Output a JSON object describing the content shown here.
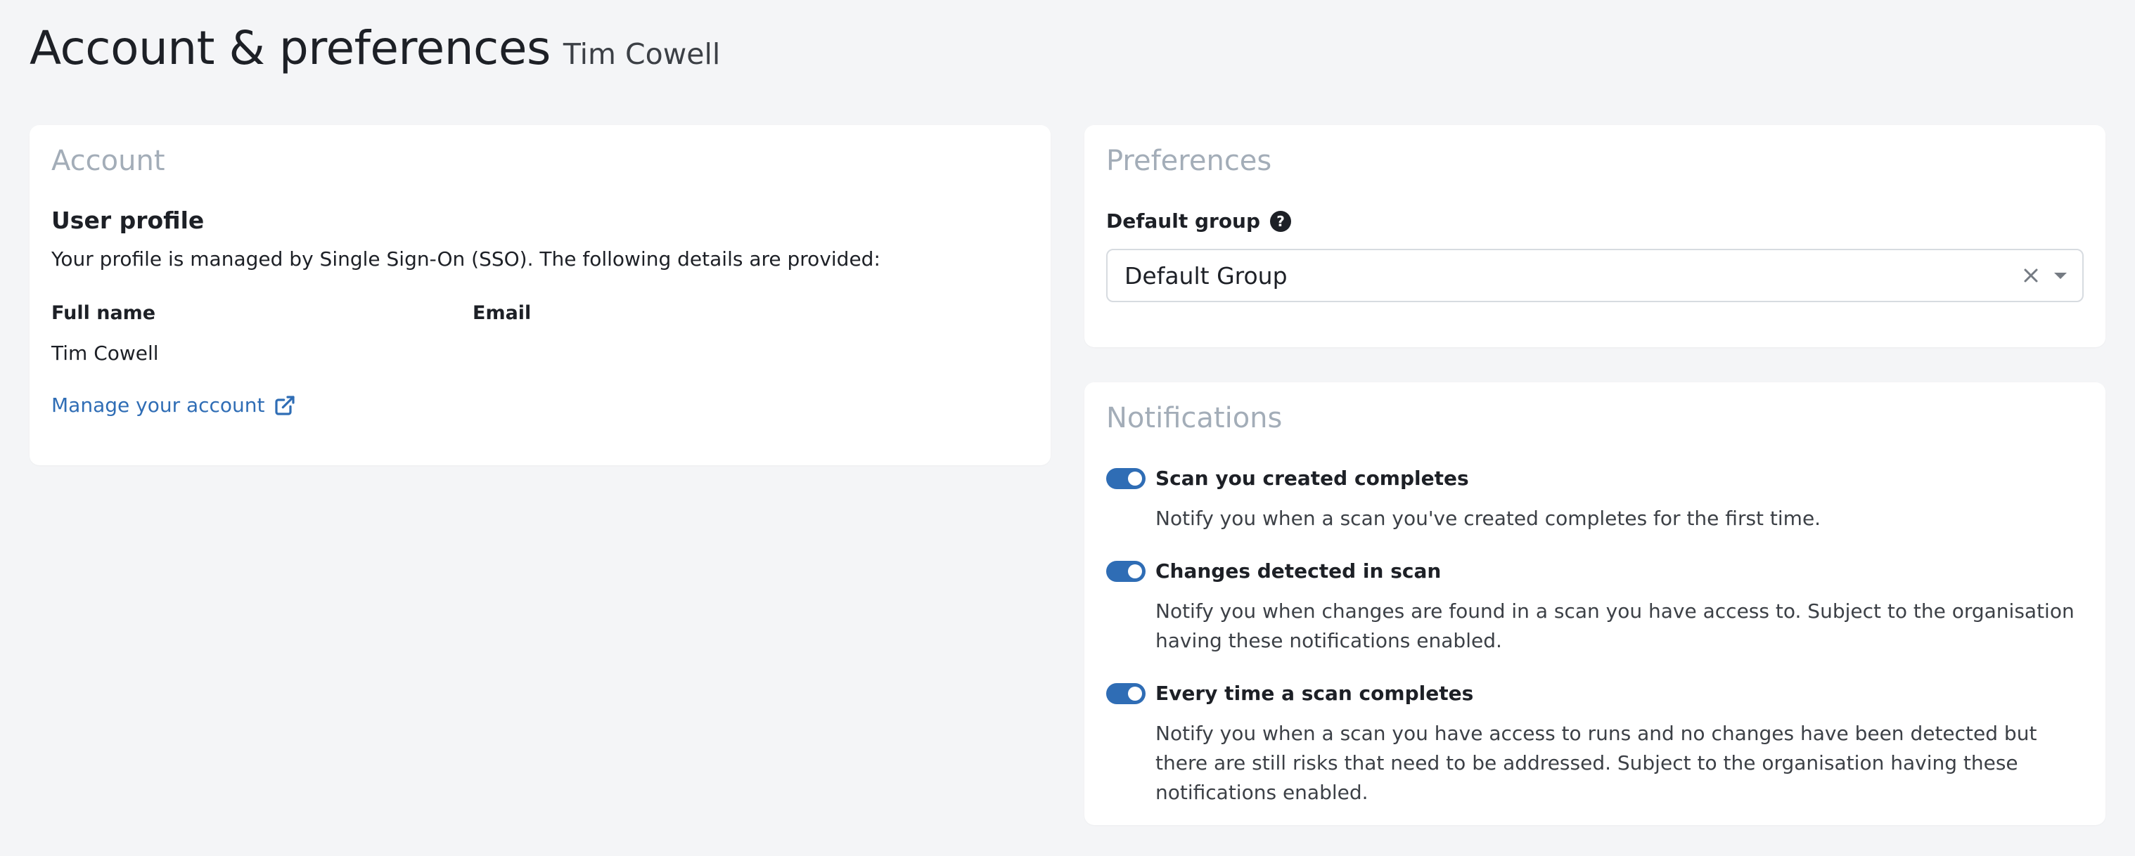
{
  "header": {
    "title": "Account & preferences",
    "user_name": "Tim Cowell"
  },
  "account": {
    "card_title": "Account",
    "section_title": "User profile",
    "description": "Your profile is managed by Single Sign-On (SSO). The following details are provided:",
    "full_name_label": "Full name",
    "email_label": "Email",
    "full_name_value": "Tim Cowell",
    "email_value": "",
    "manage_link_label": "Manage your account",
    "manage_link_icon": "external-link-icon"
  },
  "preferences": {
    "card_title": "Preferences",
    "default_group_label": "Default group",
    "help_icon": "question-circle-icon",
    "help_glyph": "?",
    "default_group_value": "Default Group",
    "clear_icon": "close-icon",
    "dropdown_icon": "chevron-down-icon"
  },
  "notifications": {
    "card_title": "Notifications",
    "items": [
      {
        "title": "Scan you created completes",
        "description": "Notify you when a scan you've created completes for the first time.",
        "enabled": true
      },
      {
        "title": "Changes detected in scan",
        "description": "Notify you when changes are found in a scan you have access to. Subject to the organisation having these notifications enabled.",
        "enabled": true
      },
      {
        "title": "Every time a scan completes",
        "description": "Notify you when a scan you have access to runs and no changes have been detected but there are still risks that need to be addressed. Subject to the organisation having these notifications enabled.",
        "enabled": true
      }
    ]
  },
  "colors": {
    "background": "#f4f5f7",
    "card": "#ffffff",
    "accent": "#2f6db5",
    "muted_title": "#a3adb8",
    "text": "#1d2026"
  }
}
